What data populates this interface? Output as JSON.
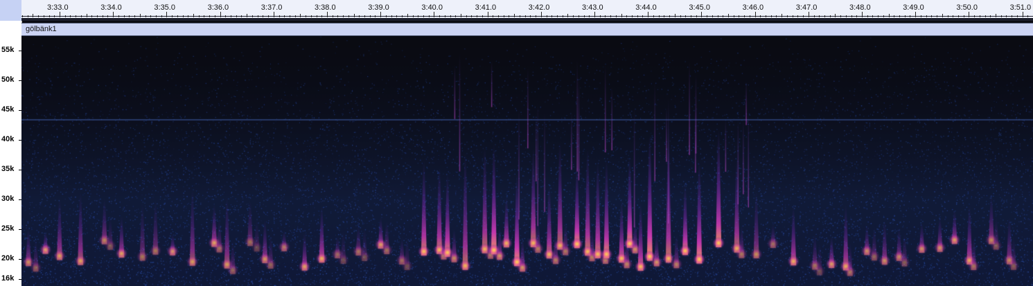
{
  "timeline": {
    "labels": [
      "3:33.0",
      "3:34.0",
      "3:35.0",
      "3:36.0",
      "3:37.0",
      "3:38.0",
      "3:39.0",
      "3:40.0",
      "3:41.0",
      "3:42.0",
      "3:43.0",
      "3:44.0",
      "3:45.0",
      "3:46.0",
      "3:47.0",
      "3:48.0",
      "3:49.0",
      "3:50.0",
      "3:51.0"
    ]
  },
  "track": {
    "name": "gölbänk1"
  },
  "frequency_axis": {
    "labels": [
      "55k",
      "50k",
      "45k",
      "40k",
      "35k",
      "30k",
      "25k",
      "20k",
      "16k"
    ]
  },
  "colors": {
    "background": "#0a0b12",
    "noise": "#1a2a55",
    "accent": "#ff9a3c"
  }
}
